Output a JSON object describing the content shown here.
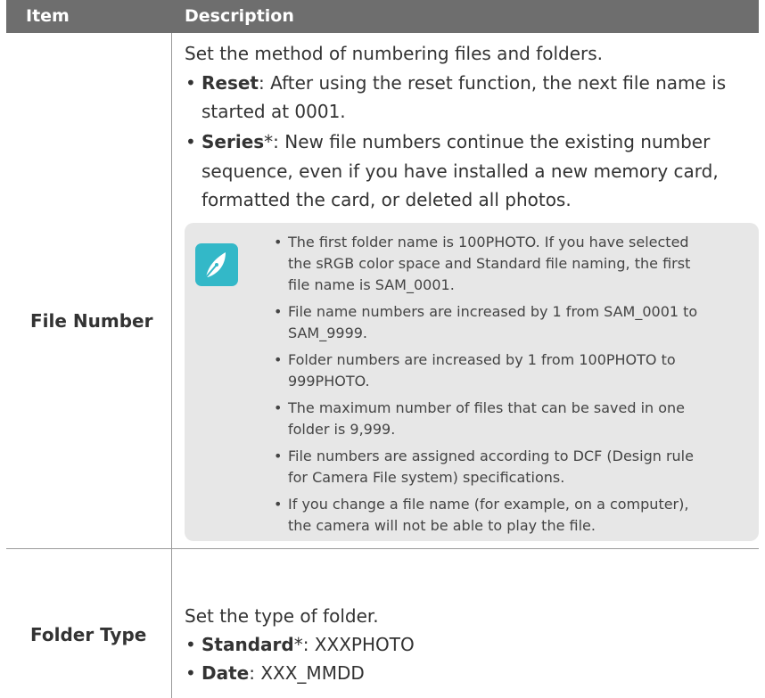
{
  "header": {
    "col_item": "Item",
    "col_description": "Description"
  },
  "rows": [
    {
      "item": "File Number",
      "intro": "Set the method of numbering files and folders.",
      "bullets": [
        {
          "bold": "Reset",
          "rest_lines": [
            ": After using the reset function, the next file name is",
            "started at 0001."
          ]
        },
        {
          "bold": "Series",
          "rest_lines": [
            "*: New file numbers continue the existing number",
            "sequence, even if you have installed a new memory card,",
            "formatted the card, or deleted all photos."
          ]
        }
      ],
      "note_icon": "pen-nib-icon",
      "notes": [
        [
          "The first folder name is 100PHOTO. If you have selected",
          "the sRGB color space and Standard file naming, the first",
          "file name is SAM_0001."
        ],
        [
          "File name numbers are increased by 1 from SAM_0001 to",
          "SAM_9999."
        ],
        [
          "Folder numbers are increased by 1 from 100PHOTO to",
          "999PHOTO."
        ],
        [
          "The maximum number of files that can be saved in one",
          "folder is 9,999."
        ],
        [
          "File numbers are assigned according to DCF (Design rule",
          "for Camera File system) specifications."
        ],
        [
          "If you change a file name (for example, on a computer),",
          "the camera will not be able to play the file."
        ]
      ]
    },
    {
      "item": "Folder Type",
      "intro": "Set the type of folder.",
      "bullets": [
        {
          "bold": "Standard",
          "rest_lines": [
            "*: XXXPHOTO"
          ]
        },
        {
          "bold": "Date",
          "rest_lines": [
            ": XXX_MMDD"
          ]
        }
      ]
    }
  ],
  "colors": {
    "header_bg": "#6e6e6e",
    "note_bg": "#e7e7e7",
    "icon_bg": "#33b8c8"
  }
}
